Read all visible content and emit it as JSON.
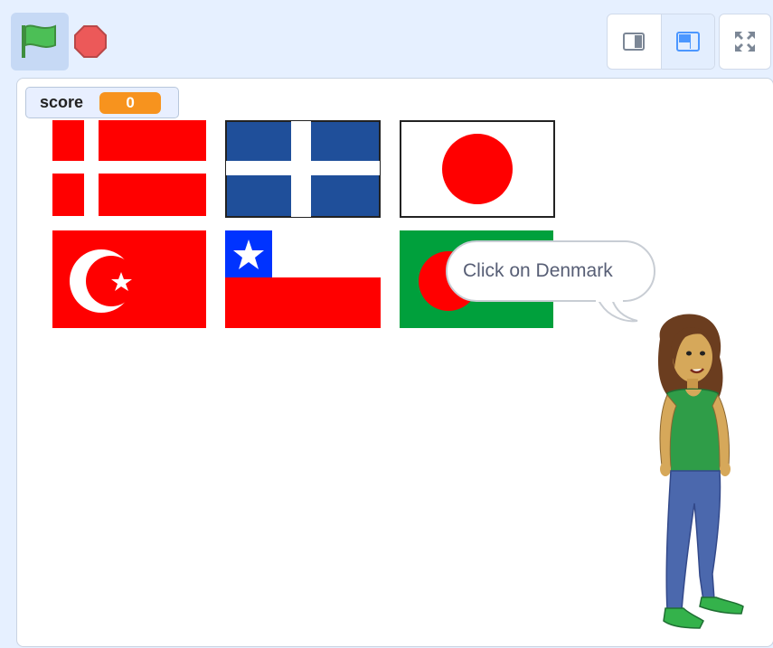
{
  "toolbar": {
    "green_flag_icon": "green-flag-icon",
    "stop_icon": "stop-sign-icon",
    "small_stage_icon": "small-stage-icon",
    "normal_stage_icon": "normal-stage-icon",
    "fullscreen_icon": "fullscreen-icon"
  },
  "monitor": {
    "label": "score",
    "value": "0"
  },
  "flags": [
    {
      "country": "denmark"
    },
    {
      "country": "finland"
    },
    {
      "country": "japan"
    },
    {
      "country": "turkey"
    },
    {
      "country": "chile"
    },
    {
      "country": "bangladesh"
    }
  ],
  "speech": {
    "text": "Click on Denmark"
  },
  "colors": {
    "accent": "#4c97ff",
    "flag_red": "#ff0000",
    "finland_blue": "#1f4f9a",
    "chile_blue": "#0033ff",
    "bangladesh_green": "#00a03c",
    "monitor_orange": "#f7931e"
  }
}
